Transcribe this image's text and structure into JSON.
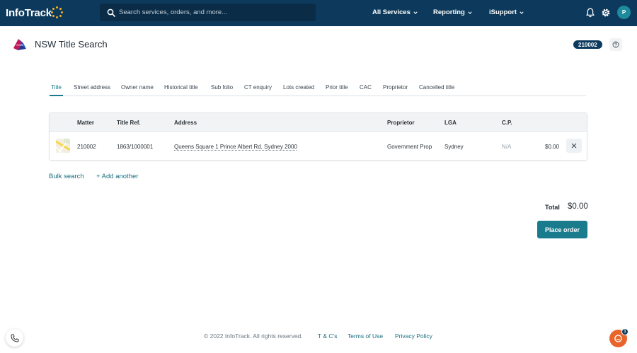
{
  "topbar": {
    "logo_text": "InfoTrack",
    "search": {
      "placeholder": "Search services, orders, and more..."
    },
    "nav": [
      {
        "label": "All Services"
      },
      {
        "label": "Reporting"
      },
      {
        "label": "iSupport"
      }
    ],
    "icons": [
      "bell-icon",
      "gear-icon"
    ],
    "avatar_initial": "P"
  },
  "header": {
    "title": "NSW Title Search",
    "matter_badge": "210002",
    "logo_badge_text": "NSW"
  },
  "tabs": [
    {
      "label": "Title",
      "active": true
    },
    {
      "label": "Street address"
    },
    {
      "label": "Owner name"
    },
    {
      "label": "Historical title"
    },
    {
      "label": "Sub folio"
    },
    {
      "label": "CT enquiry"
    },
    {
      "label": "Lots created"
    },
    {
      "label": "Prior title"
    },
    {
      "label": "CAC"
    },
    {
      "label": "Proprietor"
    },
    {
      "label": "Cancelled title"
    }
  ],
  "table": {
    "columns": [
      "Matter",
      "Title Ref.",
      "Address",
      "Proprietor",
      "LGA",
      "C.P."
    ],
    "rows": [
      {
        "matter": "210002",
        "title_ref": "1863/1000001",
        "address": "Queens Square 1 Prince Albert Rd, Sydney 2000",
        "proprietor": "Government Prop",
        "lga": "Sydney",
        "cp": "N/A",
        "price": "$0.00"
      }
    ]
  },
  "actions": {
    "bulk_search": "Bulk search",
    "add_another": "+ Add another"
  },
  "totals": {
    "label": "Total",
    "value": "$0.00",
    "place_order": "Place order"
  },
  "footer": {
    "copyright": "© 2022 InfoTrack. All rights reserved.",
    "links": [
      "T & C's",
      "Terms of Use",
      "Privacy Policy"
    ],
    "chat_badge": "1"
  },
  "colors": {
    "navbar": "#0d3a5c",
    "accent": "#1a7b8c",
    "chat": "#e8642b",
    "logo_dots": "#f5b021"
  }
}
